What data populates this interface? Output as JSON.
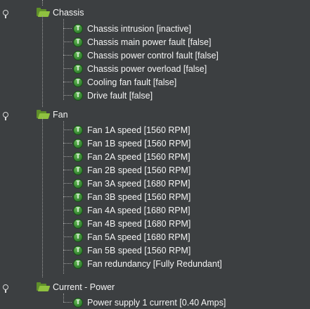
{
  "tree": {
    "groups": [
      {
        "label": "Chassis",
        "icon": "folder-open-icon",
        "items": [
          "Chassis intrusion [inactive]",
          "Chassis main power fault [false]",
          "Chassis power control fault [false]",
          "Chassis power overload [false]",
          "Cooling fan fault [false]",
          "Drive fault [false]"
        ]
      },
      {
        "label": "Fan",
        "icon": "folder-open-icon",
        "items": [
          "Fan 1A speed [1560 RPM]",
          "Fan 1B speed [1560 RPM]",
          "Fan 2A speed [1560 RPM]",
          "Fan 2B speed [1560 RPM]",
          "Fan 3A speed [1680 RPM]",
          "Fan 3B speed [1560 RPM]",
          "Fan 4A speed [1680 RPM]",
          "Fan 4B speed [1680 RPM]",
          "Fan 5A speed [1680 RPM]",
          "Fan 5B speed [1560 RPM]",
          "Fan redundancy [Fully Redundant]"
        ]
      },
      {
        "label": "Current - Power",
        "icon": "folder-open-icon",
        "items": [
          "Power supply 1 current [0.40 Amps]"
        ]
      }
    ],
    "leaf_icon_letter": "T",
    "colors": {
      "background": "#3c3f41",
      "folder": "#8fc13f",
      "leaf_icon": "#2e7d2c"
    }
  }
}
